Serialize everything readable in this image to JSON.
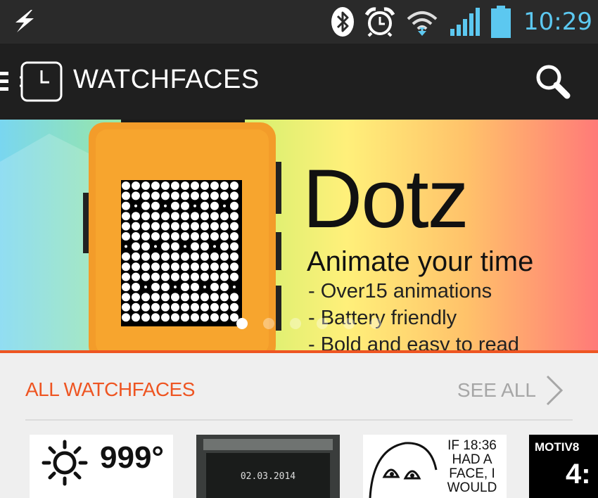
{
  "status_bar": {
    "time": "10:29",
    "icons": [
      "lightning-icon",
      "bluetooth-icon",
      "alarm-icon",
      "wifi-icon",
      "signal-icon",
      "battery-icon"
    ],
    "time_color": "#5cc8f0"
  },
  "app_bar": {
    "title": "WATCHFACES",
    "icons": [
      "menu-drawer-icon",
      "watch-app-icon",
      "search-icon"
    ]
  },
  "banner": {
    "headline": "Dotz",
    "tagline": "Animate your time",
    "features": [
      "- Over15 animations",
      "- Battery friendly",
      "- Bold and easy to read"
    ],
    "page_count": 6,
    "active_page": 1
  },
  "section": {
    "title": "ALL WATCHFACES",
    "see_all": "SEE ALL",
    "accent_color": "#ee5522"
  },
  "tiles": [
    {
      "temp": "999°",
      "icon": "sun-icon"
    },
    {
      "date": "02.03.2014"
    },
    {
      "text": [
        "IF 18:36",
        "HAD A",
        "FACE, I",
        "WOULD"
      ]
    },
    {
      "brand": "MOTIV8",
      "time": "4:"
    }
  ]
}
